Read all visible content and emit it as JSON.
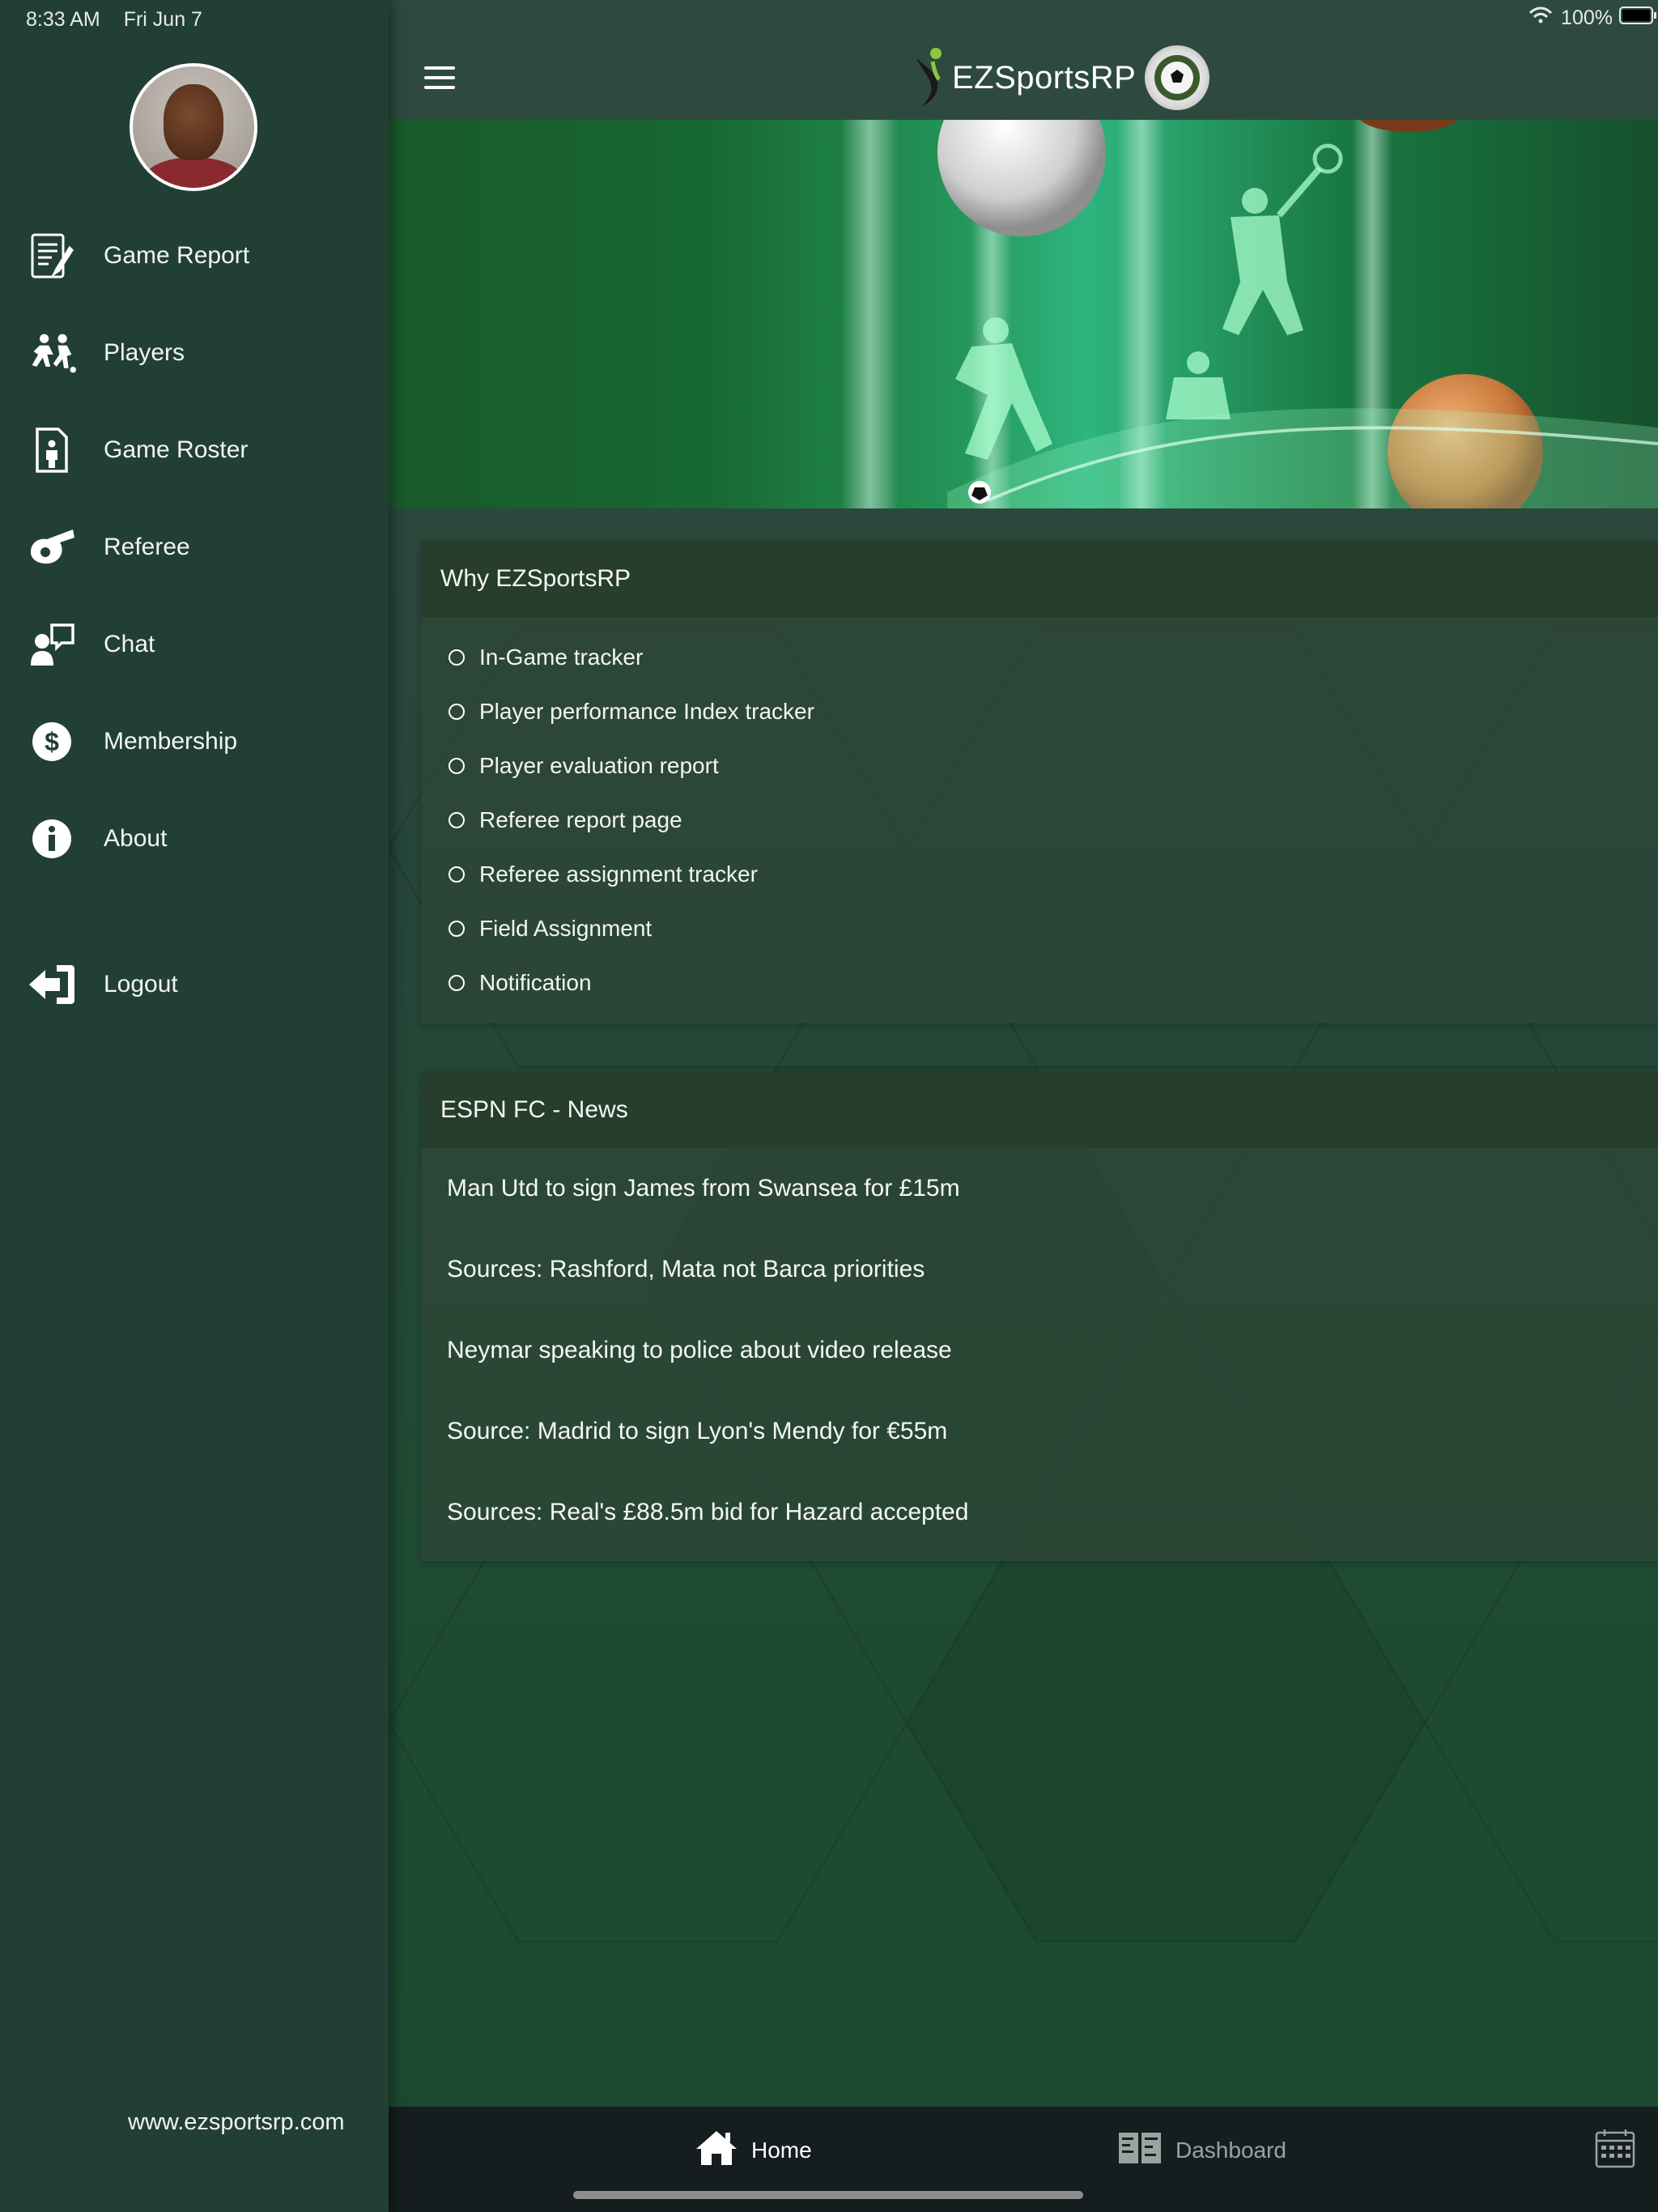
{
  "status": {
    "time": "8:33 AM",
    "date": "Fri Jun 7",
    "battery": "100%"
  },
  "sidebar": {
    "items": [
      {
        "label": "Game Report",
        "icon": "report-icon"
      },
      {
        "label": "Players",
        "icon": "players-icon"
      },
      {
        "label": "Game Roster",
        "icon": "roster-icon"
      },
      {
        "label": "Referee",
        "icon": "whistle-icon"
      },
      {
        "label": "Chat",
        "icon": "chat-icon"
      },
      {
        "label": "Membership",
        "icon": "dollar-icon"
      },
      {
        "label": "About",
        "icon": "info-icon"
      }
    ],
    "logout": {
      "label": "Logout",
      "icon": "logout-icon"
    },
    "website": "www.ezsportsrp.com"
  },
  "header": {
    "brand": "EZSportsRP"
  },
  "why_card": {
    "title": "Why EZSportsRP",
    "features": [
      "In-Game tracker",
      "Player performance Index tracker",
      "Player evaluation report",
      "Referee report page",
      "Referee assignment tracker",
      "Field Assignment",
      "Notification"
    ]
  },
  "news_card": {
    "title": "ESPN FC - News",
    "items": [
      "Man Utd to sign James from Swansea for £15m",
      "Sources: Rashford, Mata not Barca priorities",
      "Neymar speaking to police about video release",
      "Source: Madrid to sign Lyon's Mendy for €55m",
      "Sources: Real's £88.5m bid for Hazard accepted"
    ]
  },
  "tabs": [
    {
      "label": "Home",
      "icon": "home-icon",
      "active": true
    },
    {
      "label": "Dashboard",
      "icon": "dashboard-icon",
      "active": false
    }
  ],
  "colors": {
    "sidebar": "#223f33",
    "tabbar": "#161d1f",
    "active_tab": "#ffffff",
    "inactive_tab": "#9aa3a0"
  }
}
